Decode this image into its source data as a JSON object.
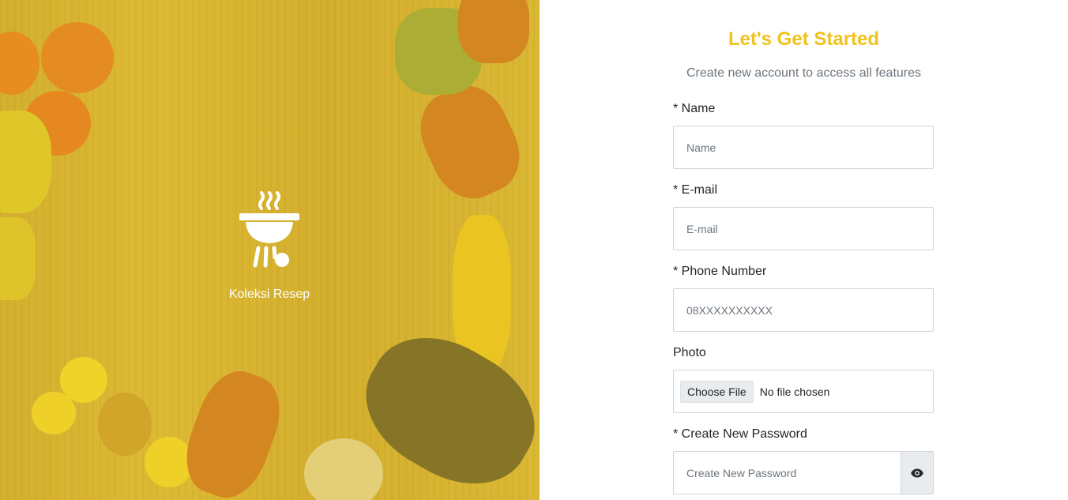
{
  "brand": {
    "name": "Koleksi Resep",
    "icon": "grill-icon"
  },
  "form": {
    "title": "Let's Get Started",
    "subtitle": "Create new account to access all features",
    "fields": {
      "name": {
        "label": "* Name",
        "placeholder": "Name"
      },
      "email": {
        "label": "* E-mail",
        "placeholder": "E-mail"
      },
      "phone": {
        "label": "* Phone Number",
        "placeholder": "08XXXXXXXXXX"
      },
      "photo": {
        "label": "Photo",
        "button": "Choose File",
        "status": "No file chosen"
      },
      "password": {
        "label": "* Create New Password",
        "placeholder": "Create New Password",
        "toggle_icon": "eye-icon"
      }
    }
  },
  "colors": {
    "accent": "#f0c21b",
    "muted_text": "#6c757d",
    "overlay": "#f0c828"
  }
}
